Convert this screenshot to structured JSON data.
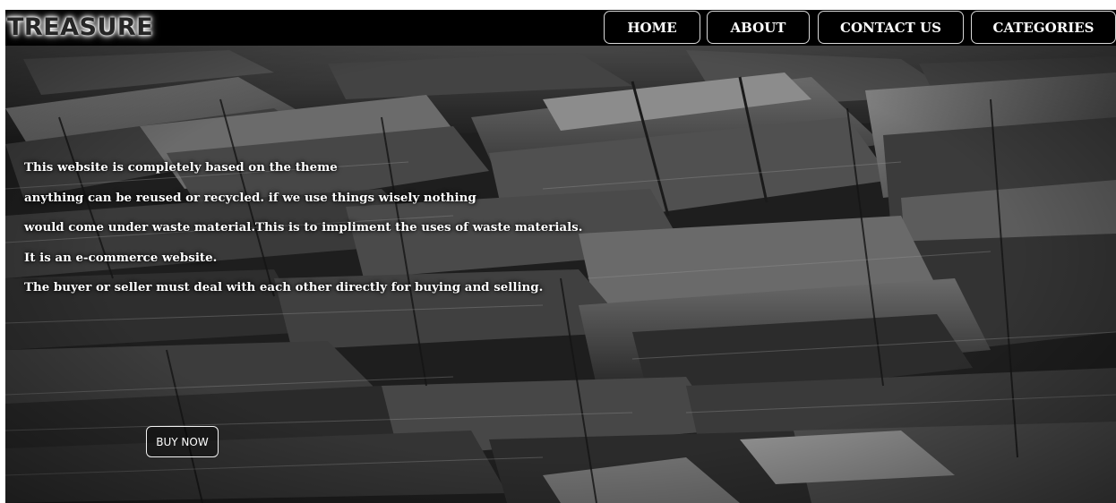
{
  "header": {
    "logo_text": "TREASURE",
    "nav": {
      "home": "HOME",
      "about": "ABOUT",
      "contact": "CONTACT US",
      "categories": "CATEGORIES"
    }
  },
  "hero": {
    "lines": [
      "This website is completely based on the theme",
      "anything can be reused or recycled. if we use things wisely nothing",
      "would come under waste material.This is to impliment the uses of waste materials.",
      "It is an e-commerce website.",
      "The buyer or seller must deal with each other directly for buying and selling."
    ],
    "buy_button": "BUY NOW"
  },
  "colors": {
    "topbar": "#000000",
    "text": "#ffffff",
    "background": "#151515"
  }
}
